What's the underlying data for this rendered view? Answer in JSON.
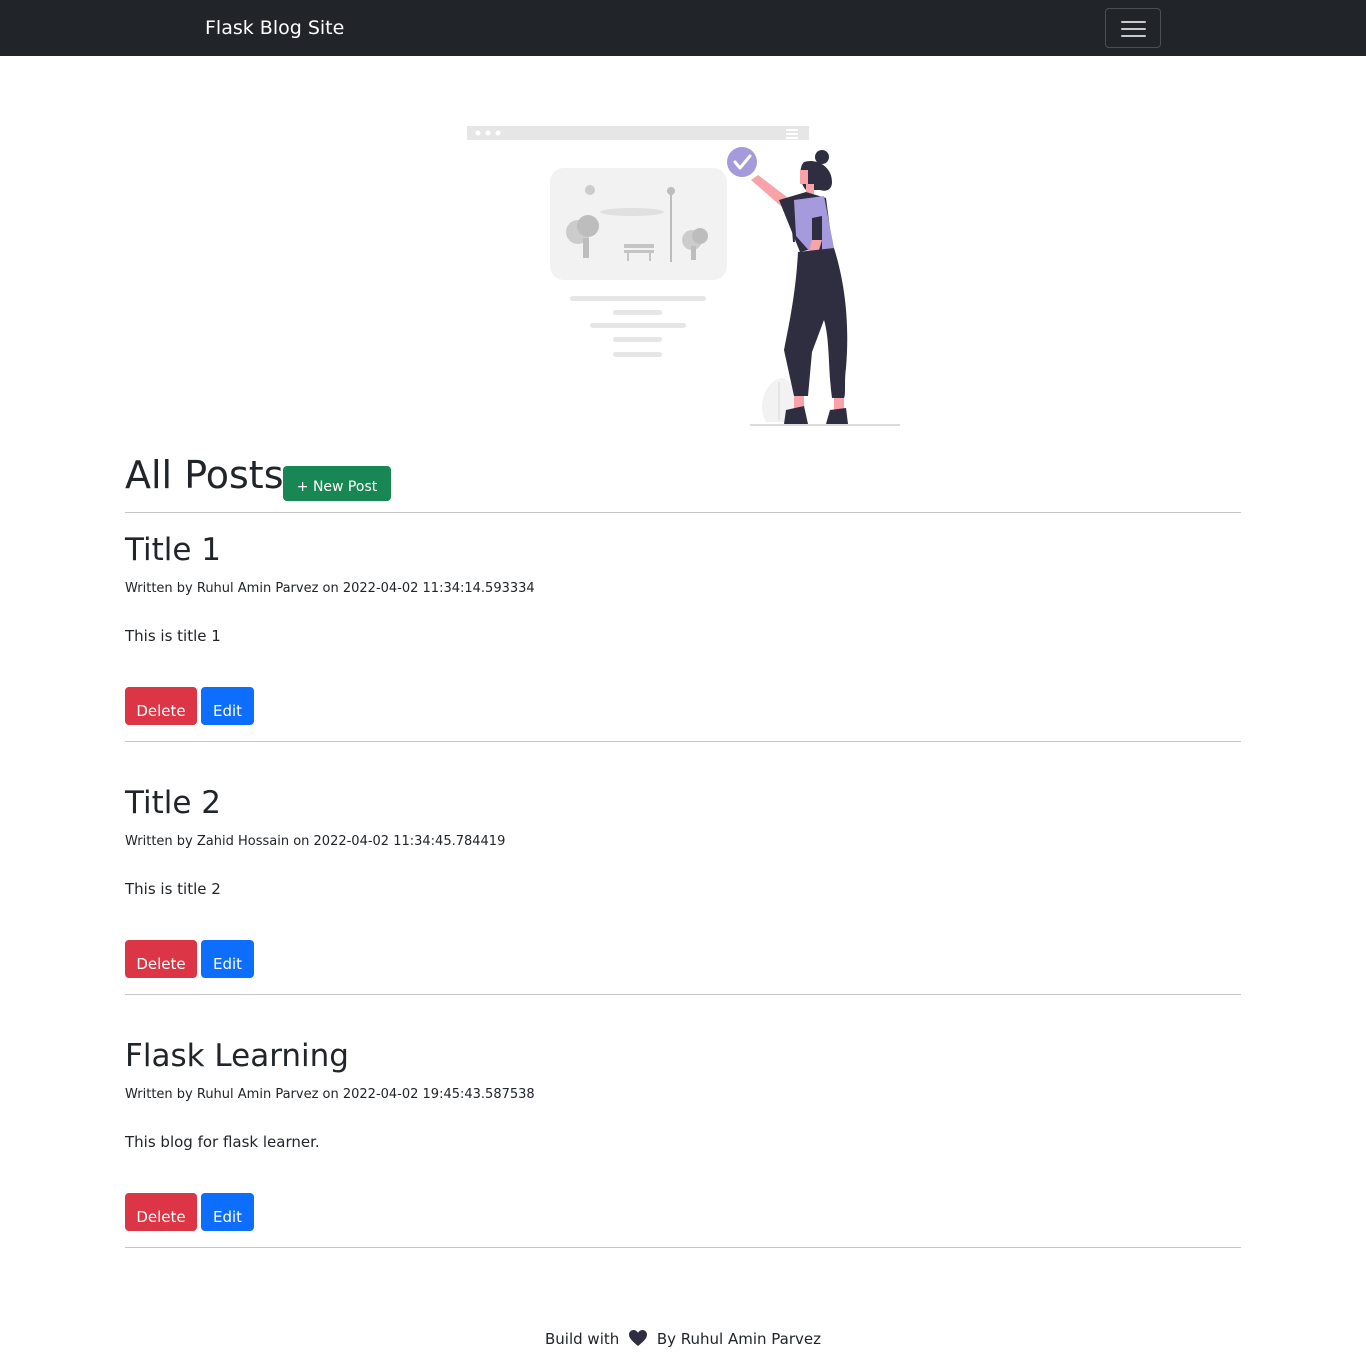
{
  "navbar": {
    "brand": "Flask Blog Site",
    "toggle_icon": "hamburger-menu-icon"
  },
  "hero": {
    "illustration": "woman-pointing-at-webpage-illustration",
    "colors": {
      "accent": "#a59bdc",
      "dark": "#2f2e41",
      "skin": "#f8a3a8",
      "gray": "#e6e6e6"
    }
  },
  "main": {
    "title": "All Posts",
    "new_post_label": "+ New Post"
  },
  "posts": [
    {
      "title": "Title 1",
      "meta": "Written by Ruhul Amin Parvez on 2022-04-02 11:34:14.593334",
      "body": "This is title 1",
      "delete_label": "Delete",
      "edit_label": "Edit"
    },
    {
      "title": "Title 2",
      "meta": "Written by Zahid Hossain on 2022-04-02 11:34:45.784419",
      "body": "This is title 2",
      "delete_label": "Delete",
      "edit_label": "Edit"
    },
    {
      "title": "Flask Learning",
      "meta": "Written by Ruhul Amin Parvez on 2022-04-02 19:45:43.587538",
      "body": "This blog for flask learner.",
      "delete_label": "Delete",
      "edit_label": "Edit"
    }
  ],
  "footer": {
    "prefix": "Build with",
    "icon": "heart-icon",
    "suffix": "By Ruhul Amin Parvez"
  },
  "colors": {
    "navbar_bg": "#212529",
    "success": "#198754",
    "danger": "#dc3545",
    "primary": "#0d6efd"
  }
}
